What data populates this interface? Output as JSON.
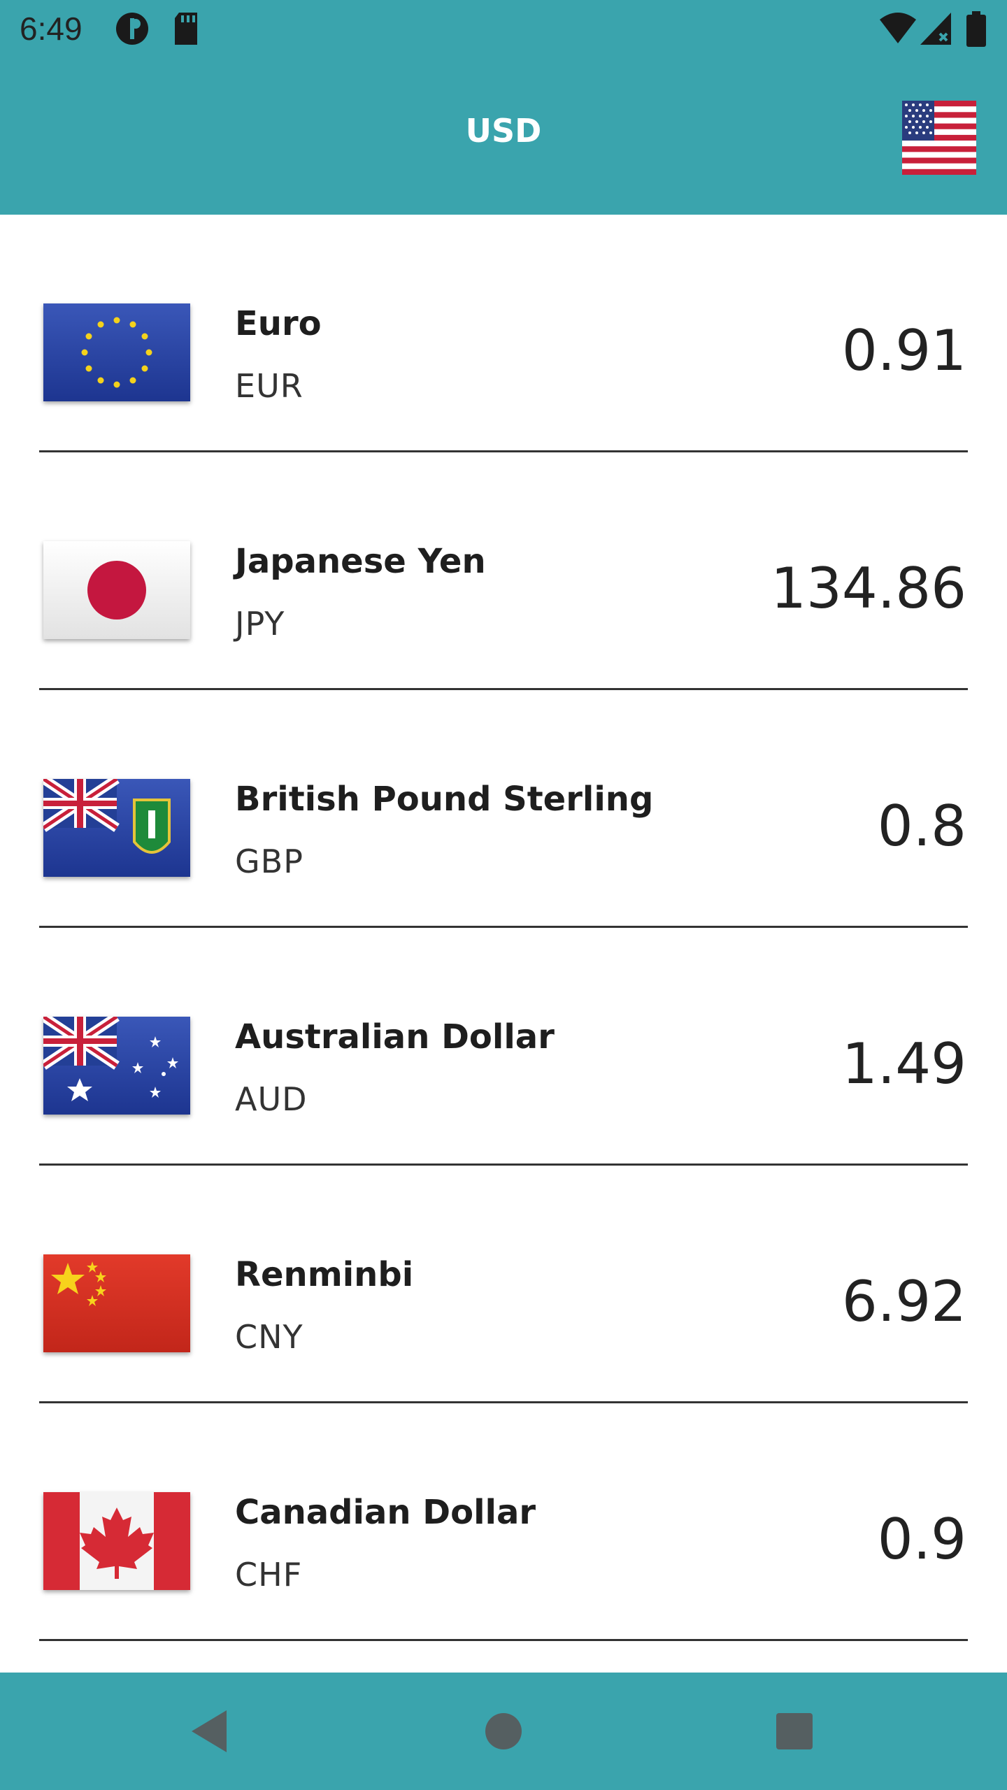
{
  "status_bar": {
    "time": "6:49",
    "icons": [
      "app-notification-icon",
      "sd-card-icon",
      "wifi-icon",
      "cell-signal-icon",
      "battery-icon"
    ]
  },
  "app_bar": {
    "title": "USD",
    "base_flag_icon": "us-flag-icon"
  },
  "currencies": [
    {
      "name": "Euro",
      "code": "EUR",
      "rate": "0.91",
      "flag": "eu-flag-icon"
    },
    {
      "name": "Japanese Yen",
      "code": "JPY",
      "rate": "134.86",
      "flag": "japan-flag-icon"
    },
    {
      "name": "British Pound Sterling",
      "code": "GBP",
      "rate": "0.8",
      "flag": "british-virgin-islands-flag-icon"
    },
    {
      "name": "Australian Dollar",
      "code": "AUD",
      "rate": "1.49",
      "flag": "australia-flag-icon"
    },
    {
      "name": "Renminbi",
      "code": "CNY",
      "rate": "6.92",
      "flag": "china-flag-icon"
    },
    {
      "name": "Canadian Dollar",
      "code": "CHF",
      "rate": "0.9",
      "flag": "canada-flag-icon"
    }
  ],
  "nav_bar": {
    "icons": [
      "back-icon",
      "home-icon",
      "recents-icon"
    ]
  },
  "colors": {
    "primary": "#3aa4ad",
    "background": "#ffffff",
    "divider": "#333333"
  }
}
